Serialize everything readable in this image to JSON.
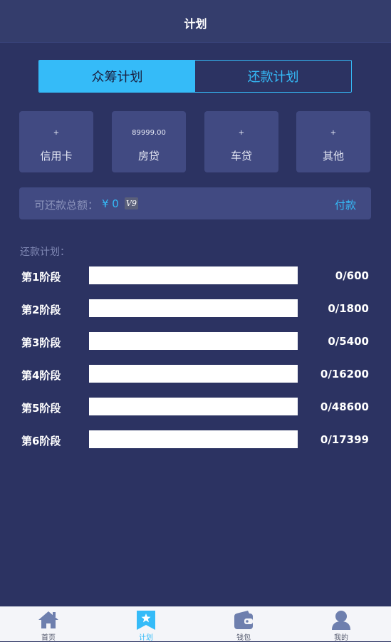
{
  "header": {
    "title": "计划"
  },
  "tabs": [
    {
      "label": "众筹计划",
      "active": true
    },
    {
      "label": "还款计划",
      "active": false
    }
  ],
  "categories": [
    {
      "value": "+",
      "label": "信用卡"
    },
    {
      "value": "89999.00",
      "label": "房贷"
    },
    {
      "value": "+",
      "label": "车贷"
    },
    {
      "value": "+",
      "label": "其他"
    }
  ],
  "summary": {
    "label": "可还款总额：",
    "amount": "¥ 0",
    "vip_badge": "V9",
    "pay_label": "付款"
  },
  "plan": {
    "heading": "还款计划：",
    "stages": [
      {
        "label": "第1阶段",
        "progress": "0/600",
        "fraction": 0
      },
      {
        "label": "第2阶段",
        "progress": "0/1800",
        "fraction": 0
      },
      {
        "label": "第3阶段",
        "progress": "0/5400",
        "fraction": 0
      },
      {
        "label": "第4阶段",
        "progress": "0/16200",
        "fraction": 0
      },
      {
        "label": "第5阶段",
        "progress": "0/48600",
        "fraction": 0
      },
      {
        "label": "第6阶段",
        "progress": "0/17399",
        "fraction": 0
      }
    ]
  },
  "bottom_nav": [
    {
      "label": "首页",
      "icon": "home-icon",
      "active": false
    },
    {
      "label": "计划",
      "icon": "star-bookmark-icon",
      "active": true
    },
    {
      "label": "钱包",
      "icon": "wallet-icon",
      "active": false
    },
    {
      "label": "我的",
      "icon": "user-icon",
      "active": false
    }
  ],
  "colors": {
    "background": "#2c3362",
    "header": "#343d6c",
    "card": "#414a82",
    "accent": "#35bbf8",
    "nav_icon": "#6e7fae"
  }
}
